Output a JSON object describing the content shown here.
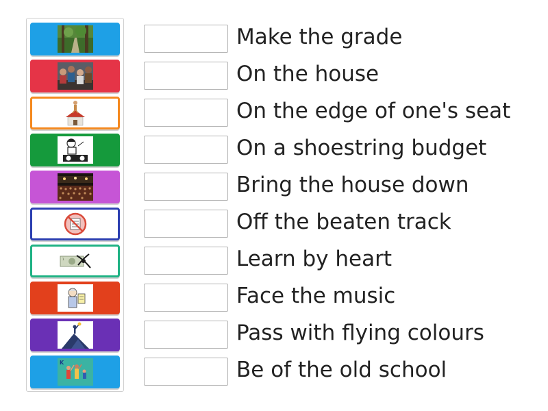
{
  "phrases": [
    "Make the grade",
    "On the house",
    "On the edge of one's seat",
    "On a shoestring budget",
    "Bring the house down",
    "Off the beaten track",
    "Learn by heart",
    "Face the music",
    "Pass with flying colours",
    "Be of the old school"
  ],
  "tiles": [
    {
      "color": "#1ea0e6",
      "style": "filled",
      "image": "forest-path-photo"
    },
    {
      "color": "#e53447",
      "style": "filled",
      "image": "crowd-photo"
    },
    {
      "color": "#f5891f",
      "style": "outlined",
      "image": "person-on-house-clipart"
    },
    {
      "color": "#159a3c",
      "style": "filled",
      "image": "dj-turntable-clipart"
    },
    {
      "color": "#c655d6",
      "style": "filled",
      "image": "concert-audience-photo"
    },
    {
      "color": "#2c3fb1",
      "style": "outlined",
      "image": "no-speaking-sign-icon"
    },
    {
      "color": "#1fb284",
      "style": "outlined",
      "image": "dollar-bill-shoelace-photo"
    },
    {
      "color": "#e2401c",
      "style": "filled",
      "image": "elderly-person-clipart"
    },
    {
      "color": "#6a30b5",
      "style": "filled",
      "image": "person-on-mountain-illustration"
    },
    {
      "color": "#1ea0e6",
      "style": "filled",
      "image": "family-celebrating-illustration"
    }
  ]
}
